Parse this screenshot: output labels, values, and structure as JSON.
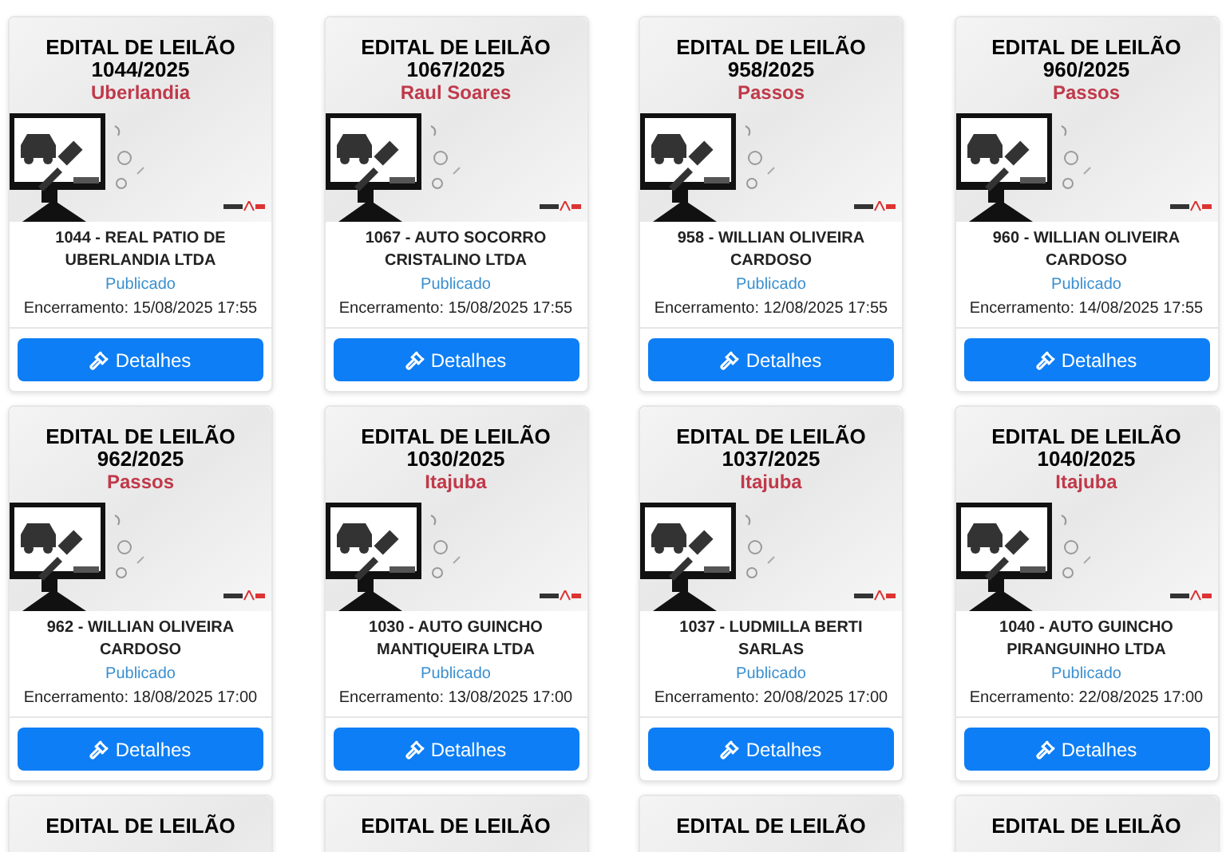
{
  "cards": [
    {
      "title": "EDITAL DE LEILÃO",
      "number": "1044/2025",
      "city": "Uberlandia",
      "name": "1044 - REAL PATIO DE UBERLANDIA LTDA",
      "status": "Publicado",
      "closing": "Encerramento: 15/08/2025 17:55",
      "button": "Detalhes"
    },
    {
      "title": "EDITAL DE LEILÃO",
      "number": "1067/2025",
      "city": "Raul Soares",
      "name": "1067 - AUTO SOCORRO CRISTALINO LTDA",
      "status": "Publicado",
      "closing": "Encerramento: 15/08/2025 17:55",
      "button": "Detalhes"
    },
    {
      "title": "EDITAL DE LEILÃO",
      "number": "958/2025",
      "city": "Passos",
      "name": "958 - WILLIAN OLIVEIRA CARDOSO",
      "status": "Publicado",
      "closing": "Encerramento: 12/08/2025 17:55",
      "button": "Detalhes"
    },
    {
      "title": "EDITAL DE LEILÃO",
      "number": "960/2025",
      "city": "Passos",
      "name": "960 - WILLIAN OLIVEIRA CARDOSO",
      "status": "Publicado",
      "closing": "Encerramento: 14/08/2025 17:55",
      "button": "Detalhes"
    },
    {
      "title": "EDITAL DE LEILÃO",
      "number": "962/2025",
      "city": "Passos",
      "name": "962 - WILLIAN OLIVEIRA CARDOSO",
      "status": "Publicado",
      "closing": "Encerramento: 18/08/2025 17:00",
      "button": "Detalhes"
    },
    {
      "title": "EDITAL DE LEILÃO",
      "number": "1030/2025",
      "city": "Itajuba",
      "name": "1030 - AUTO GUINCHO MANTIQUEIRA LTDA",
      "status": "Publicado",
      "closing": "Encerramento: 13/08/2025 17:00",
      "button": "Detalhes"
    },
    {
      "title": "EDITAL DE LEILÃO",
      "number": "1037/2025",
      "city": "Itajuba",
      "name": "1037 - LUDMILLA BERTI SARLAS",
      "status": "Publicado",
      "closing": "Encerramento: 20/08/2025 17:00",
      "button": "Detalhes"
    },
    {
      "title": "EDITAL DE LEILÃO",
      "number": "1040/2025",
      "city": "Itajuba",
      "name": "1040 - AUTO GUINCHO PIRANGUINHO LTDA",
      "status": "Publicado",
      "closing": "Encerramento: 22/08/2025 17:00",
      "button": "Detalhes"
    },
    {
      "title": "EDITAL DE LEILÃO"
    },
    {
      "title": "EDITAL DE LEILÃO"
    },
    {
      "title": "EDITAL DE LEILÃO"
    },
    {
      "title": "EDITAL DE LEILÃO"
    }
  ]
}
